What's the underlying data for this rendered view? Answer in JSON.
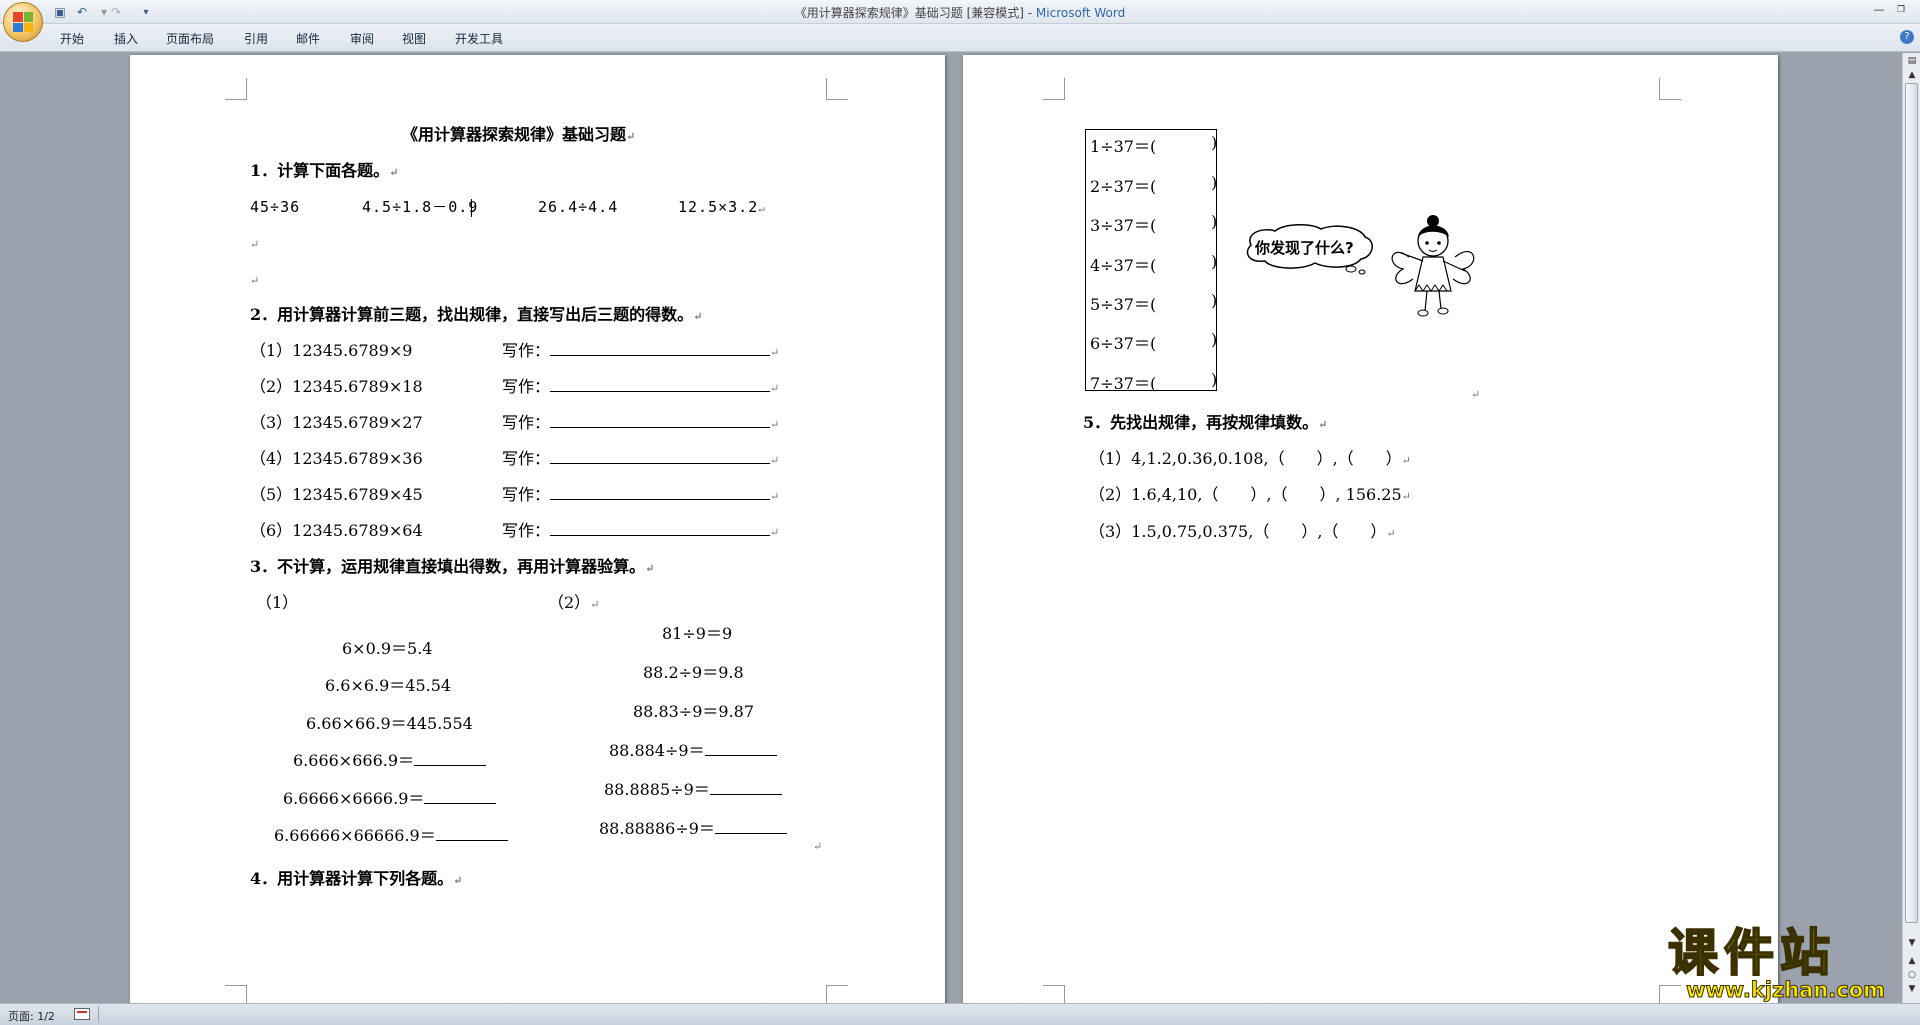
{
  "window": {
    "title_doc": "《用计算器探索规律》基础习题 [兼容模式] - ",
    "title_app": "Microsoft Word"
  },
  "ribbon": {
    "tabs": [
      "开始",
      "插入",
      "页面布局",
      "引用",
      "邮件",
      "审阅",
      "视图",
      "开发工具"
    ]
  },
  "page1": {
    "title": "《用计算器探索规律》基础习题",
    "q1": {
      "heading": "1．计算下面各题。",
      "items": [
        "45÷36",
        "4.5÷1.8－0.9",
        "26.4÷4.4",
        "12.5×3.2"
      ]
    },
    "q2": {
      "heading": "2．用计算器计算前三题，找出规律，直接写出后三题的得数。",
      "write_label": "写作：",
      "items": [
        "（1）12345.6789×9",
        "（2）12345.6789×18",
        "（3）12345.6789×27",
        "（4）12345.6789×36",
        "（5）12345.6789×45",
        "（6）12345.6789×64"
      ]
    },
    "q3": {
      "heading": "3．不计算，运用规律直接填出得数，再用计算器验算。",
      "part1_label": "（1）",
      "part2_label": "（2）",
      "part1": [
        "6×0.9＝5.4",
        "6.6×6.9＝45.54",
        "6.66×66.9＝445.554",
        "6.666×666.9＝",
        "6.6666×6666.9＝",
        "6.66666×66666.9＝"
      ],
      "part2": [
        "81÷9＝9",
        "88.2÷9＝9.8",
        "88.83÷9＝9.87",
        "88.884÷9＝",
        "88.8885÷9＝",
        "88.88886÷9＝"
      ]
    },
    "q4": {
      "heading": "4．用计算器计算下列各题。"
    }
  },
  "page2": {
    "divisions": [
      "1÷37＝(",
      "2÷37＝(",
      "3÷37＝(",
      "4÷37＝(",
      "5÷37＝(",
      "6÷37＝(",
      "7÷37＝("
    ],
    "close_paren": ")",
    "bubble_text": "你发现了什么?",
    "q5": {
      "heading": "5．先找出规律，再按规律填数。",
      "items": [
        "（1）4,1.2,0.36,0.108,（　　）,（　　）",
        "（2）1.6,4,10,（　　）,（　　）, 156.25",
        "（3）1.5,0.75,0.375,（　　）,（　　）"
      ]
    }
  },
  "status": {
    "page": "页面: 1/2"
  },
  "watermark": {
    "cn": "课件站",
    "url": "www.kjzhan.com"
  },
  "marks": {
    "para": "↵"
  }
}
